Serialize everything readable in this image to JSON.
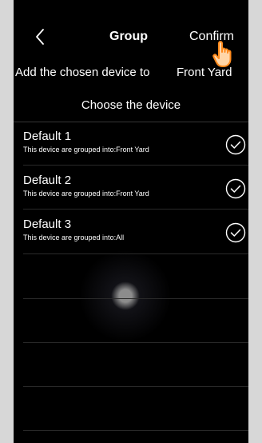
{
  "header": {
    "back_icon": "chevron-left-icon",
    "title": "Group",
    "confirm_label": "Confirm"
  },
  "add_line": {
    "prefix": "Add the chosen device to",
    "target": "Front Yard"
  },
  "choose_label": "Choose the device",
  "devices": [
    {
      "name": "Default 1",
      "subtitle": "This device are grouped into:Front Yard",
      "checked": true
    },
    {
      "name": "Default 2",
      "subtitle": "This device are grouped into:Front Yard",
      "checked": true
    },
    {
      "name": "Default 3",
      "subtitle": "This device are grouped into:All",
      "checked": true
    }
  ],
  "icons": {
    "check": "check-circle-icon",
    "cursor": "hand-pointer-icon"
  },
  "colors": {
    "background": "#000000",
    "text": "#ffffff",
    "frame": "#d7d7d7"
  }
}
